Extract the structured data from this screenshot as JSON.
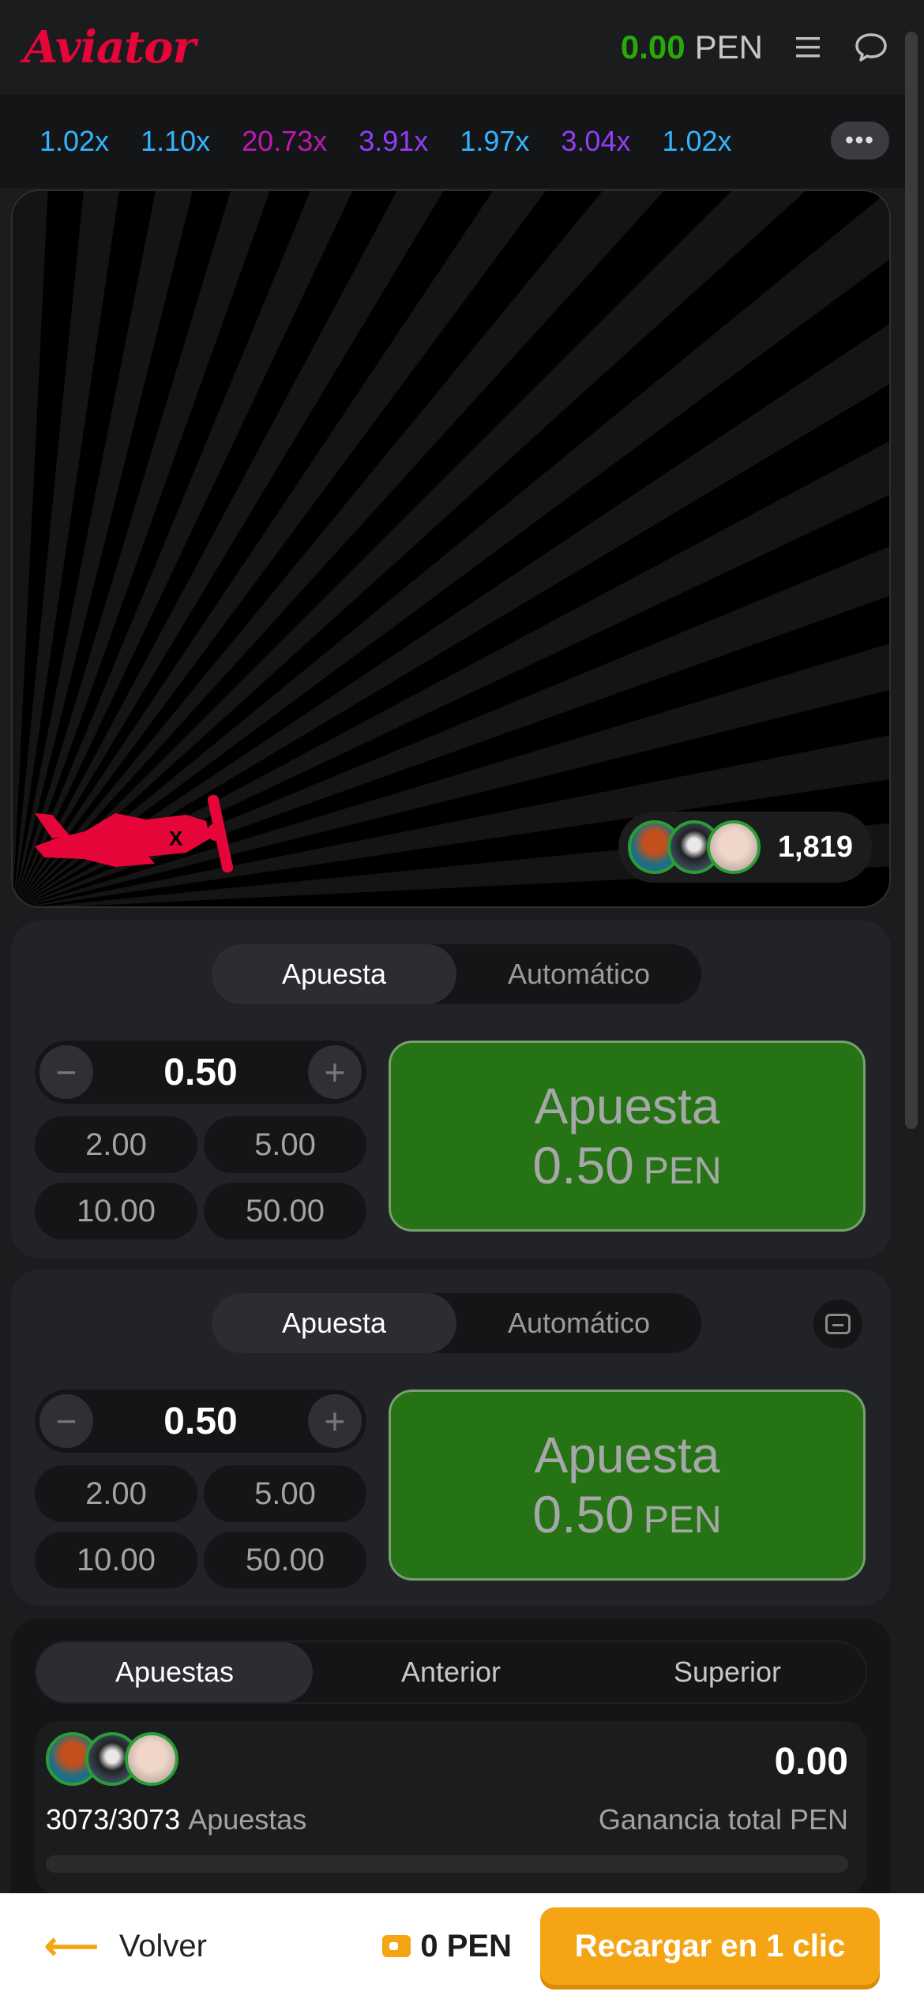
{
  "header": {
    "logo": "Aviator",
    "balance_amount": "0.00",
    "balance_currency": "PEN"
  },
  "multipliers": [
    {
      "value": "1.02x",
      "color": "#34b4ff"
    },
    {
      "value": "1.10x",
      "color": "#34b4ff"
    },
    {
      "value": "20.73x",
      "color": "#c017b4"
    },
    {
      "value": "3.91x",
      "color": "#913ef8"
    },
    {
      "value": "1.97x",
      "color": "#34b4ff"
    },
    {
      "value": "3.04x",
      "color": "#913ef8"
    },
    {
      "value": "1.02x",
      "color": "#34b4ff"
    }
  ],
  "game": {
    "players_count": "1,819"
  },
  "bet_panels": [
    {
      "tabs": [
        "Apuesta",
        "Automático"
      ],
      "active_tab": 0,
      "amount": "0.50",
      "quick_amounts": [
        "2.00",
        "5.00",
        "10.00",
        "50.00"
      ],
      "button_label": "Apuesta",
      "button_amount": "0.50",
      "button_currency": "PEN"
    },
    {
      "tabs": [
        "Apuesta",
        "Automático"
      ],
      "active_tab": 0,
      "amount": "0.50",
      "quick_amounts": [
        "2.00",
        "5.00",
        "10.00",
        "50.00"
      ],
      "button_label": "Apuesta",
      "button_amount": "0.50",
      "button_currency": "PEN"
    }
  ],
  "bets": {
    "tabs": [
      "Apuestas",
      "Anterior",
      "Superior"
    ],
    "count": "3073/3073",
    "count_label": "Apuestas",
    "total_win": "0.00",
    "total_win_label": "Ganancia total PEN"
  },
  "footer": {
    "back_label": "Volver",
    "wallet_amount": "0 PEN",
    "recharge_label": "Recargar en 1 clic"
  },
  "colors": {
    "accent_red": "#e50539",
    "green": "#28a909",
    "orange": "#f5a514"
  }
}
